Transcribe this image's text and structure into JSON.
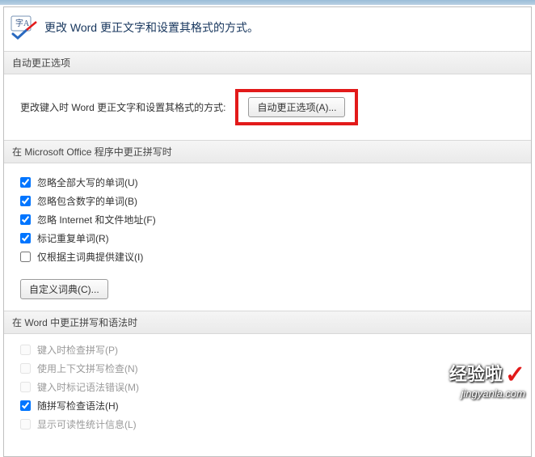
{
  "header": {
    "title": "更改 Word 更正文字和设置其格式的方式。"
  },
  "sections": {
    "autocorrect_options": {
      "title": "自动更正选项",
      "row_label": "更改键入时 Word 更正文字和设置其格式的方式:",
      "button": "自动更正选项(A)..."
    },
    "office_spell": {
      "title": "在 Microsoft Office 程序中更正拼写时",
      "items": [
        {
          "label": "忽略全部大写的单词(U)",
          "checked": true,
          "disabled": false
        },
        {
          "label": "忽略包含数字的单词(B)",
          "checked": true,
          "disabled": false
        },
        {
          "label": "忽略 Internet 和文件地址(F)",
          "checked": true,
          "disabled": false
        },
        {
          "label": "标记重复单词(R)",
          "checked": true,
          "disabled": false
        },
        {
          "label": "仅根据主词典提供建议(I)",
          "checked": false,
          "disabled": false
        }
      ],
      "dict_button": "自定义词典(C)..."
    },
    "word_spell_grammar": {
      "title": "在 Word 中更正拼写和语法时",
      "items": [
        {
          "label": "键入时检查拼写(P)",
          "checked": false,
          "disabled": true
        },
        {
          "label": "使用上下文拼写检查(N)",
          "checked": false,
          "disabled": true
        },
        {
          "label": "键入时标记语法错误(M)",
          "checked": false,
          "disabled": true
        },
        {
          "label": "随拼写检查语法(H)",
          "checked": true,
          "disabled": false
        },
        {
          "label": "显示可读性统计信息(L)",
          "checked": false,
          "disabled": true
        }
      ]
    }
  },
  "watermark": {
    "main": "经验啦",
    "sub": "jingyanla.com"
  }
}
